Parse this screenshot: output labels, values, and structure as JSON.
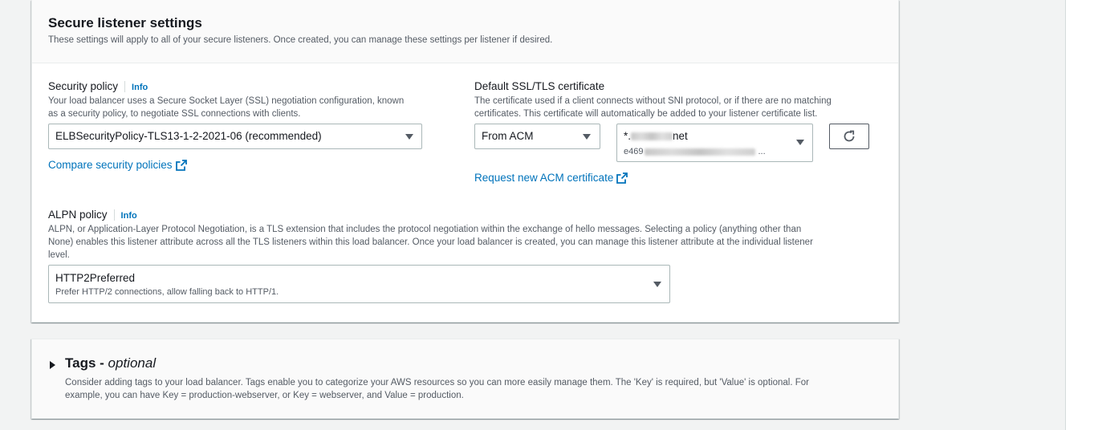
{
  "secure_listener": {
    "title": "Secure listener settings",
    "description": "These settings will apply to all of your secure listeners. Once created, you can manage these settings per listener if desired."
  },
  "security_policy": {
    "label": "Security policy",
    "info": "Info",
    "description_line1": "Your load balancer uses a Secure Socket Layer (SSL) negotiation configuration, known",
    "description_line2": "as a security policy, to negotiate SSL connections with clients.",
    "selected": "ELBSecurityPolicy-TLS13-1-2-2021-06 (recommended)",
    "compare_link": "Compare security policies"
  },
  "certificate": {
    "label": "Default SSL/TLS certificate",
    "description_line1": "The certificate used if a client connects without SNI protocol, or if there are no matching",
    "description_line2": "certificates. This certificate will automatically be added to your listener certificate list.",
    "source": "From ACM",
    "cert_prefix": "*.",
    "cert_suffix": "net",
    "cert_id_prefix": "e469",
    "cert_id_ellipsis": "...",
    "request_link": "Request new ACM certificate"
  },
  "alpn": {
    "label": "ALPN policy",
    "info": "Info",
    "description_line1": "ALPN, or Application-Layer Protocol Negotiation, is a TLS extension that includes the protocol negotiation within the exchange of hello messages. Selecting a policy (anything other than",
    "description_line2": "None) enables this listener attribute across all the TLS listeners within this load balancer. Once your load balancer is created, you can manage this listener attribute at the individual listener",
    "description_line3": "level.",
    "selected": "HTTP2Preferred",
    "selected_desc": "Prefer HTTP/2 connections, allow falling back to HTTP/1."
  },
  "tags": {
    "title": "Tags -",
    "optional": "optional",
    "description_line1": "Consider adding tags to your load balancer. Tags enable you to categorize your AWS resources so you can more easily manage them. The 'Key' is required, but 'Value' is optional. For",
    "description_line2": "example, you can have Key = production-webserver, or Key = webserver, and Value = production."
  },
  "colors": {
    "link": "#0073bb",
    "text": "#16191f",
    "secondary_text": "#545b64",
    "border": "#aab7b8"
  }
}
